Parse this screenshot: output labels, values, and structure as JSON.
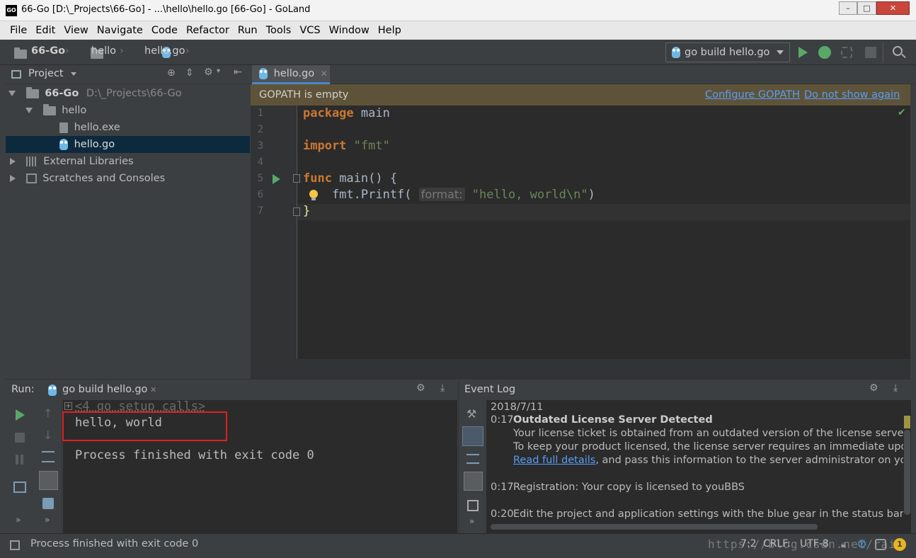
{
  "window": {
    "logo": "GO",
    "title": "66-Go [D:\\_Projects\\66-Go] - ...\\hello\\hello.go [66-Go] - GoLand",
    "minimize": "–",
    "maximize": "□",
    "close": "✕"
  },
  "menu": [
    "File",
    "Edit",
    "View",
    "Navigate",
    "Code",
    "Refactor",
    "Run",
    "Tools",
    "VCS",
    "Window",
    "Help"
  ],
  "breadcrumb": {
    "project": "66-Go",
    "folder": "hello",
    "file": "hello.go"
  },
  "run_config": {
    "label": "go build hello.go"
  },
  "project_panel": {
    "title": "Project",
    "tree": [
      {
        "label": "66-Go",
        "path": "D:\\_Projects\\66-Go"
      },
      {
        "label": "hello"
      },
      {
        "label": "hello.exe"
      },
      {
        "label": "hello.go"
      },
      {
        "label": "External Libraries"
      },
      {
        "label": "Scratches and Consoles"
      }
    ]
  },
  "editor": {
    "tab": "hello.go",
    "banner": {
      "text": "GOPATH is empty",
      "configure": "Configure GOPATH",
      "dismiss": "Do not show again"
    },
    "line_numbers": [
      "1",
      "2",
      "3",
      "4",
      "5",
      "6",
      "7"
    ],
    "code": {
      "l1_kw": "package",
      "l1_rest": " main",
      "l3_kw": "import",
      "l3_str": "\"fmt\"",
      "l5_kw": "func",
      "l5_rest": " main() {",
      "l6_pre": "    fmt.Printf( ",
      "l6_hint": "format:",
      "l6_str": "\"hello, world\\n\"",
      "l6_post": ")",
      "l7": "}"
    }
  },
  "run_panel": {
    "label": "Run:",
    "tab": "go build hello.go",
    "console": {
      "fold": "<4 go setup calls>",
      "output": "hello, world",
      "exit": "Process finished with exit code 0"
    }
  },
  "event_log": {
    "title": "Event Log",
    "date": "2018/7/11",
    "entries": [
      {
        "time": "0:17",
        "title": "Outdated License Server Detected",
        "line1": "Your license ticket is obtained from an outdated version of the license server.",
        "line2": "To keep your product licensed, the license server requires an immediate update to t",
        "link": "Read full details",
        "line3": ", and pass this information to the server administrator on your side."
      },
      {
        "time": "0:17",
        "text": "Registration: Your copy is licensed to youBBS"
      },
      {
        "time": "0:20",
        "text": "Edit the project and application settings with the blue gear in the status bar"
      }
    ]
  },
  "status_bar": {
    "message": "Process finished with exit code 0",
    "position": "7:2",
    "line_sep": "CRLF:",
    "encoding": "UTF-8",
    "watermark": "https://blog.csdn.net/rain",
    "notifications": "1"
  },
  "colors": {
    "accent": "#4a88c7",
    "run_green": "#59a869",
    "highlight_box": "#e02020",
    "link": "#589df6"
  }
}
